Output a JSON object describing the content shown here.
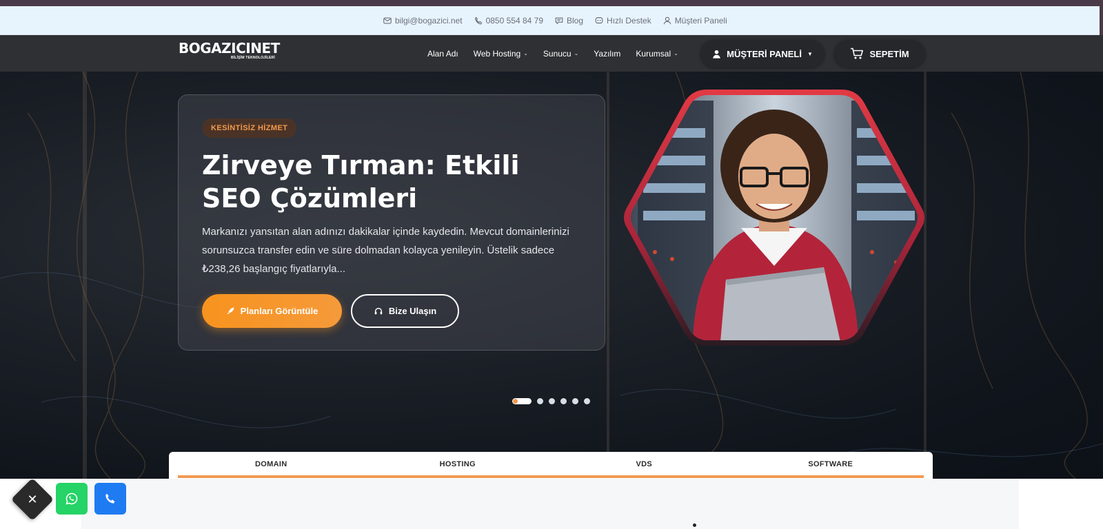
{
  "topbar": {
    "items": [
      {
        "label": "bilgi@bogazici.net",
        "icon": "mail-icon"
      },
      {
        "label": "0850 554 84 79",
        "icon": "phone-icon"
      },
      {
        "label": "Blog",
        "icon": "chat-icon"
      },
      {
        "label": "Hızlı Destek",
        "icon": "support-icon"
      },
      {
        "label": "Müşteri Paneli",
        "icon": "user-icon"
      }
    ]
  },
  "navbar": {
    "logo": "BOGAZICINET",
    "logo_sub": "BİLİŞİM TEKNOLOJİLERİ",
    "links": [
      {
        "label": "Alan Adı",
        "dropdown": false
      },
      {
        "label": "Web Hosting",
        "dropdown": true
      },
      {
        "label": "Sunucu",
        "dropdown": true
      },
      {
        "label": "Yazılım",
        "dropdown": false
      },
      {
        "label": "Kurumsal",
        "dropdown": true
      }
    ],
    "customer_panel": "MÜŞTERİ PANELİ",
    "cart": "SEPETİM"
  },
  "hero": {
    "badge": "KESİNTİSİZ HİZMET",
    "title": "Zirveye Tırman: Etkili SEO Çözümleri",
    "description": "Markanızı yansıtan alan adınızı dakikalar içinde kaydedin. Mevcut domainlerinizi sorunsuzca transfer edin ve süre dolmadan kolayca yenileyin. Üstelik sadece ₺238,26 başlangıç fiyatlarıyla...",
    "primary_button": "Planları Görüntüle",
    "secondary_button": "Bize Ulaşın",
    "slides_total": 6,
    "active_slide": 1
  },
  "tabs": [
    "DOMAIN",
    "HOSTING",
    "VDS",
    "SOFTWARE"
  ],
  "floating": {
    "close": "✕",
    "whatsapp": "whatsapp-icon",
    "call": "phone-icon"
  },
  "colors": {
    "accent": "#f7931e",
    "navbar": "#2f3033",
    "info_bar": "#e8f4fd",
    "hex_border": "#d8343f",
    "whatsapp": "#25d366",
    "call": "#1e7bf2"
  }
}
